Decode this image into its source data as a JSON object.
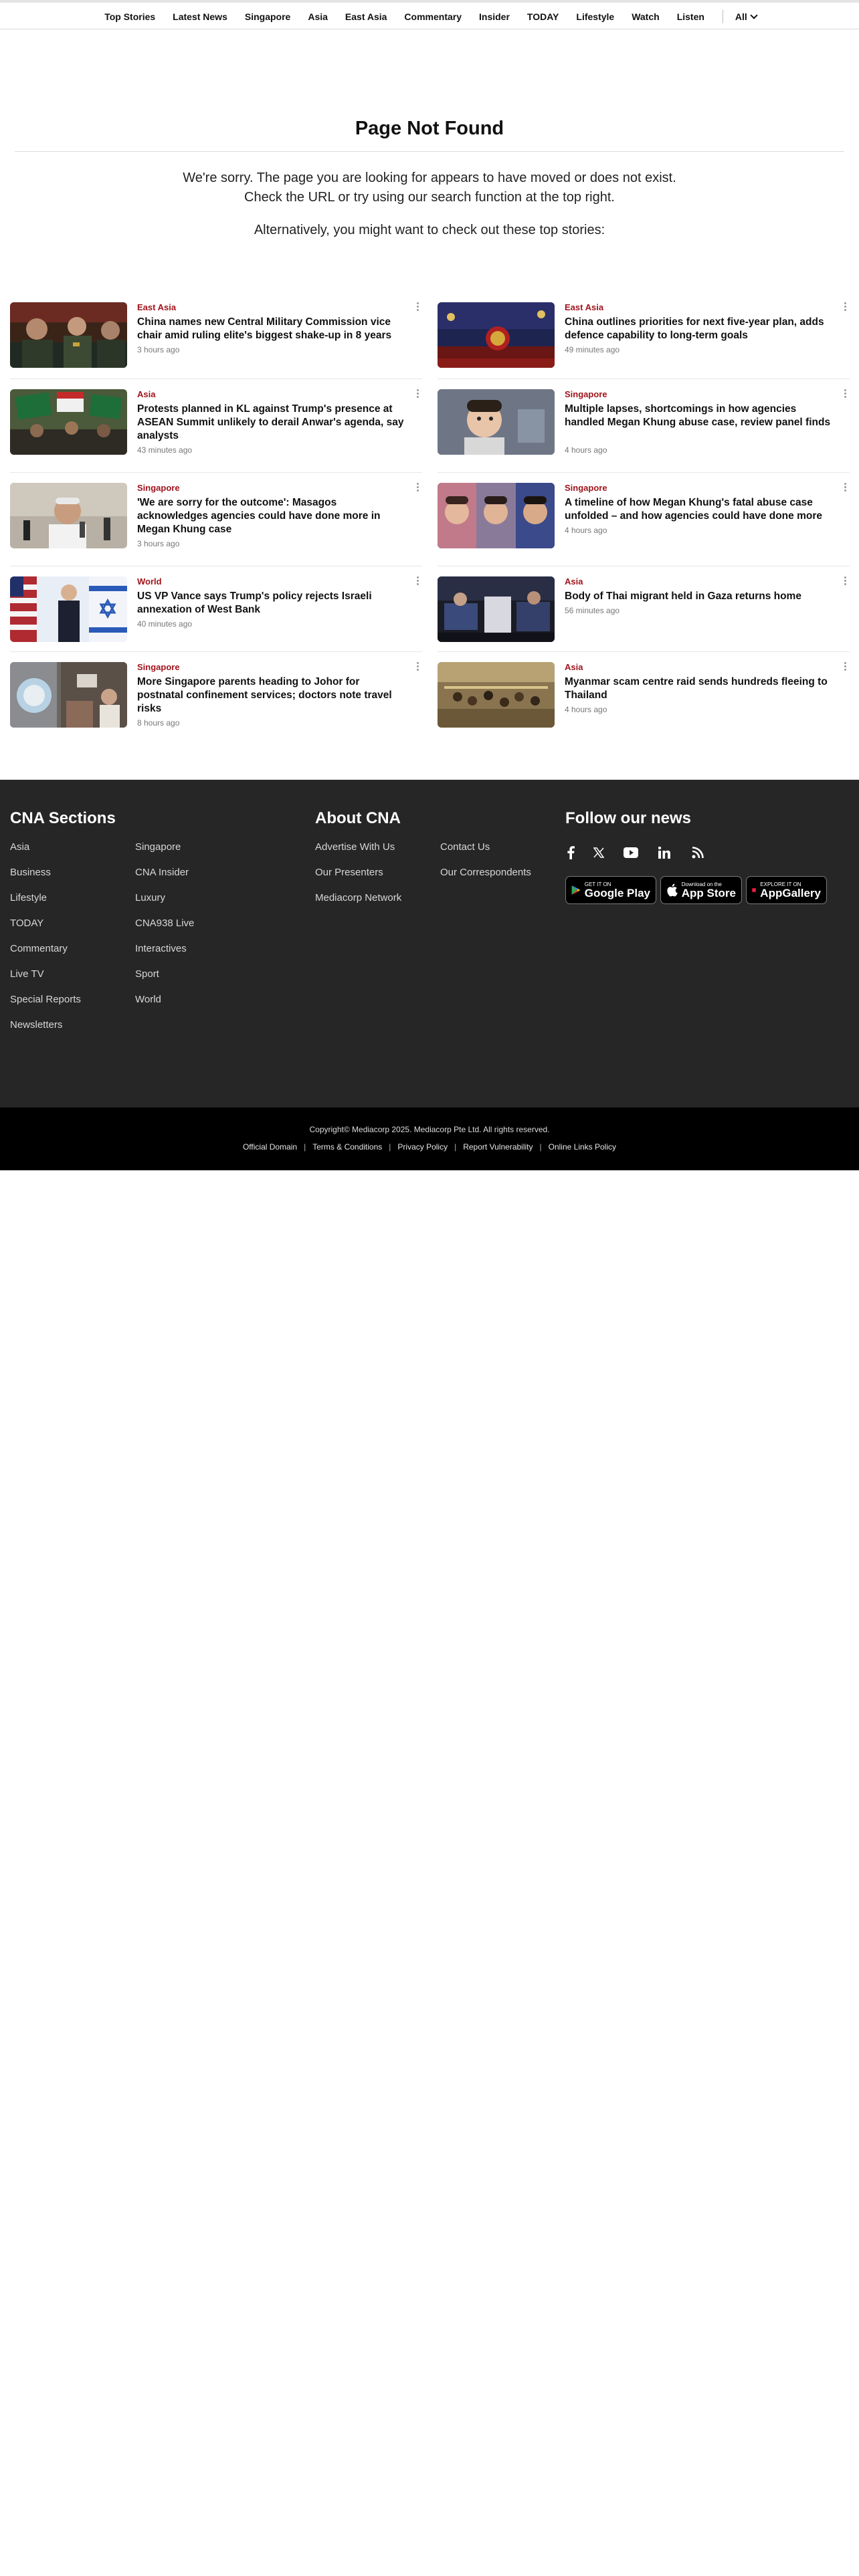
{
  "nav": {
    "items": [
      "Top Stories",
      "Latest News",
      "Singapore",
      "Asia",
      "East Asia",
      "Commentary",
      "Insider",
      "TODAY",
      "Lifestyle",
      "Watch",
      "Listen"
    ],
    "all_label": "All"
  },
  "page": {
    "title": "Page Not Found",
    "message_line1": "We're sorry. The page you are looking for appears to have moved or does not exist.",
    "message_line2": "Check the URL or try using our search function at the top right.",
    "alternative": "Alternatively, you might want to check out these top stories:"
  },
  "stories": [
    {
      "category": "East Asia",
      "headline": "China names new Central Military Commission vice chair amid ruling elite's biggest shake-up in 8 years",
      "time": "3 hours ago"
    },
    {
      "category": "East Asia",
      "headline": "China outlines priorities for next five-year plan, adds defence capability to long-term goals",
      "time": "49 minutes ago"
    },
    {
      "category": "Asia",
      "headline": "Protests planned in KL against Trump's presence at ASEAN Summit unlikely to derail Anwar's agenda, say analysts",
      "time": "43 minutes ago"
    },
    {
      "category": "Singapore",
      "headline": "Multiple lapses, shortcomings in how agencies handled Megan Khung abuse case, review panel finds",
      "time": "4 hours ago"
    },
    {
      "category": "Singapore",
      "headline": "'We are sorry for the outcome': Masagos acknowledges agencies could have done more in Megan Khung case",
      "time": "3 hours ago"
    },
    {
      "category": "Singapore",
      "headline": "A timeline of how Megan Khung's fatal abuse case unfolded – and how agencies could have done more",
      "time": "4 hours ago"
    },
    {
      "category": "World",
      "headline": "US VP Vance says Trump's policy rejects Israeli annexation of West Bank",
      "time": "40 minutes ago"
    },
    {
      "category": "Asia",
      "headline": "Body of Thai migrant held in Gaza returns home",
      "time": "56 minutes ago"
    },
    {
      "category": "Singapore",
      "headline": "More Singapore parents heading to Johor for postnatal confinement services; doctors note travel risks",
      "time": "8 hours ago"
    },
    {
      "category": "Asia",
      "headline": "Myanmar scam centre raid sends hundreds fleeing to Thailand",
      "time": "4 hours ago"
    }
  ],
  "footer": {
    "sections_title": "CNA Sections",
    "sections_col1": [
      "Asia",
      "Business",
      "Lifestyle",
      "TODAY",
      "Commentary",
      "Live TV",
      "Special Reports",
      "Newsletters"
    ],
    "sections_col2": [
      "Singapore",
      "CNA Insider",
      "Luxury",
      "CNA938 Live",
      "Interactives",
      "Sport",
      "World"
    ],
    "about_title": "About CNA",
    "about_col1": [
      "Advertise With Us",
      "Our Presenters",
      "Mediacorp Network"
    ],
    "about_col2": [
      "Contact Us",
      "Our Correspondents"
    ],
    "follow_title": "Follow our news",
    "social_icons": [
      "facebook-icon",
      "x-icon",
      "youtube-icon",
      "linkedin-icon",
      "rss-icon"
    ],
    "apps": [
      {
        "small": "GET IT ON",
        "big": "Google Play"
      },
      {
        "small": "Download on the",
        "big": "App Store"
      },
      {
        "small": "EXPLORE IT ON",
        "big": "AppGallery"
      }
    ]
  },
  "bottom": {
    "copyright": "Copyright© Mediacorp 2025. Mediacorp Pte Ltd. All rights reserved.",
    "links": [
      "Official Domain",
      "Terms & Conditions",
      "Privacy Policy",
      "Report Vulnerability",
      "Online Links Policy"
    ]
  },
  "colors": {
    "category_red": "#a0141c",
    "footer_bg": "#262626",
    "bottom_bg": "#000000"
  }
}
